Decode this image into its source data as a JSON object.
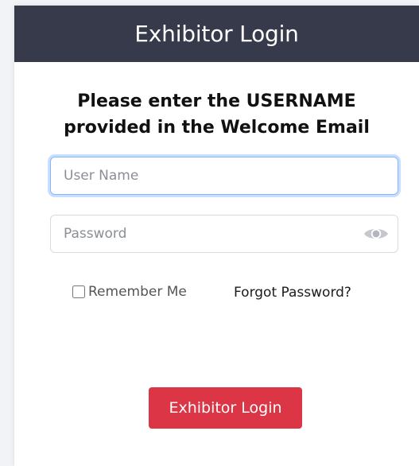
{
  "header": {
    "title": "Exhibitor Login"
  },
  "instruction": {
    "line1": "Please enter the USERNAME",
    "line2": "provided in the Welcome Email"
  },
  "form": {
    "username_placeholder": "User Name",
    "password_placeholder": "Password",
    "toggle_visibility_icon": "eye-icon",
    "remember_label": "Remember Me",
    "forgot_link": "Forgot Password?",
    "submit_label": "Exhibitor Login"
  },
  "colors": {
    "header_bg": "#363a4b",
    "button_bg": "#dc3545",
    "focus_ring": "#86b7fe"
  }
}
